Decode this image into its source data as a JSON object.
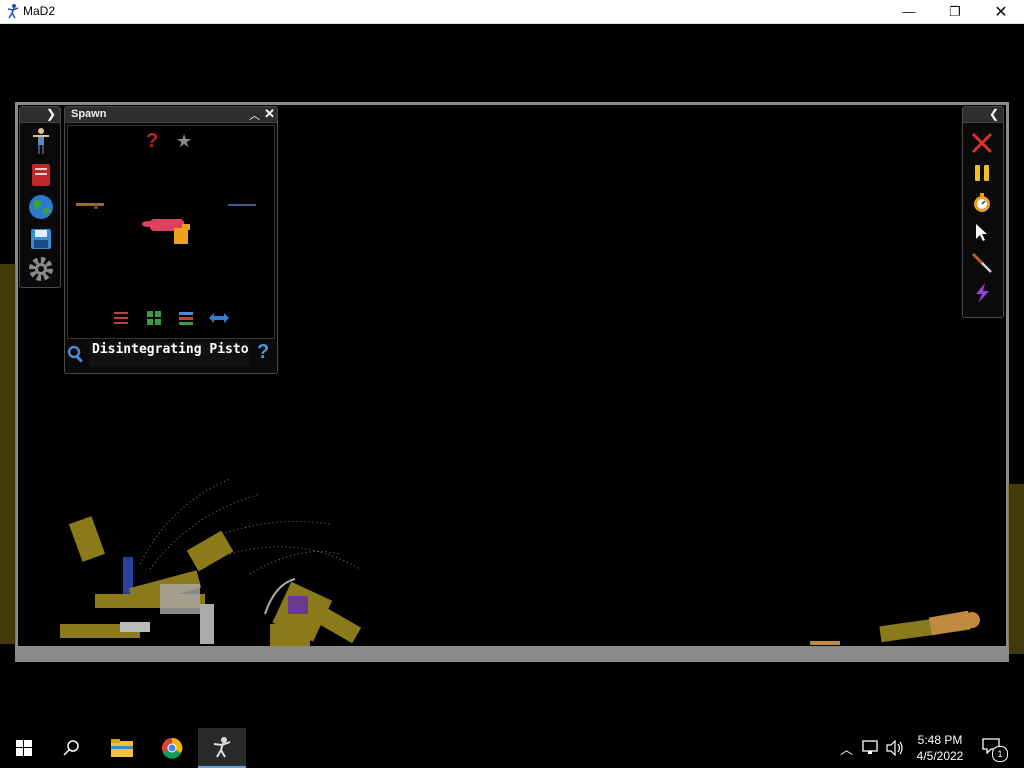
{
  "window": {
    "title": "MaD2",
    "icon": "stickman-icon"
  },
  "spawn_panel": {
    "title": "Spawn",
    "search_value": "Disintegrating Pisto",
    "items": [
      "rifle-icon",
      "disintegrating-pistol-icon",
      "sniper-rifle-icon"
    ],
    "filters": [
      "random-icon",
      "favorite-icon"
    ],
    "bottom_buttons": [
      "sort-icon",
      "grid-icon",
      "list-icon",
      "swap-icon"
    ]
  },
  "left_toolbar": [
    "spawn-character-icon",
    "book-icon",
    "world-icon",
    "save-icon",
    "settings-icon"
  ],
  "right_toolbar": [
    "delete-icon",
    "pause-icon",
    "slow-motion-icon",
    "cursor-icon",
    "knife-icon",
    "lightning-icon"
  ],
  "taskbar": {
    "apps": [
      "windows-start-icon",
      "search-icon",
      "file-explorer-icon",
      "chrome-icon",
      "mad2-icon"
    ],
    "time": "5:48 PM",
    "date": "4/5/2022",
    "notification_count": "1"
  },
  "colors": {
    "floor": "#8a8a8a",
    "grime": "#8a7a1a",
    "panel": "#0a0a0a"
  }
}
